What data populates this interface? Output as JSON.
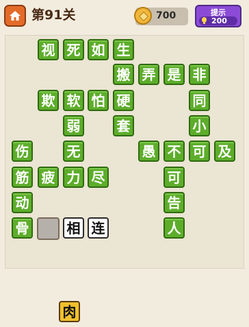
{
  "header": {
    "level_title": "第91关",
    "coins": "700",
    "hint_label": "提示",
    "hint_count": "200"
  },
  "board": {
    "tiles": [
      {
        "char": "视",
        "state": "solved"
      },
      {
        "char": "死",
        "state": "solved"
      },
      {
        "char": "如",
        "state": "solved"
      },
      {
        "char": "生",
        "state": "solved"
      },
      {
        "char": "搬",
        "state": "solved"
      },
      {
        "char": "弄",
        "state": "solved"
      },
      {
        "char": "是",
        "state": "solved"
      },
      {
        "char": "非",
        "state": "solved"
      },
      {
        "char": "欺",
        "state": "solved"
      },
      {
        "char": "软",
        "state": "solved"
      },
      {
        "char": "怕",
        "state": "solved"
      },
      {
        "char": "硬",
        "state": "solved"
      },
      {
        "char": "同",
        "state": "solved"
      },
      {
        "char": "弱",
        "state": "solved"
      },
      {
        "char": "套",
        "state": "solved"
      },
      {
        "char": "小",
        "state": "solved"
      },
      {
        "char": "伤",
        "state": "solved"
      },
      {
        "char": "无",
        "state": "solved"
      },
      {
        "char": "愚",
        "state": "solved"
      },
      {
        "char": "不",
        "state": "solved"
      },
      {
        "char": "可",
        "state": "solved"
      },
      {
        "char": "及",
        "state": "solved"
      },
      {
        "char": "筋",
        "state": "solved"
      },
      {
        "char": "疲",
        "state": "solved"
      },
      {
        "char": "力",
        "state": "solved"
      },
      {
        "char": "尽",
        "state": "solved"
      },
      {
        "char": "可",
        "state": "solved"
      },
      {
        "char": "动",
        "state": "solved"
      },
      {
        "char": "告",
        "state": "solved"
      },
      {
        "char": "骨",
        "state": "solved"
      },
      {
        "char": "",
        "state": "empty"
      },
      {
        "char": "相",
        "state": "given"
      },
      {
        "char": "连",
        "state": "given"
      },
      {
        "char": "人",
        "state": "solved"
      }
    ]
  },
  "answers": [
    {
      "char": "肉"
    }
  ],
  "colors": {
    "tile_green": "#5dad2b",
    "tile_green_border": "#2f6a0f",
    "answer_yellow": "#f2c12e",
    "hint_purple": "#8b4bd6",
    "home_orange": "#e36b2a"
  }
}
